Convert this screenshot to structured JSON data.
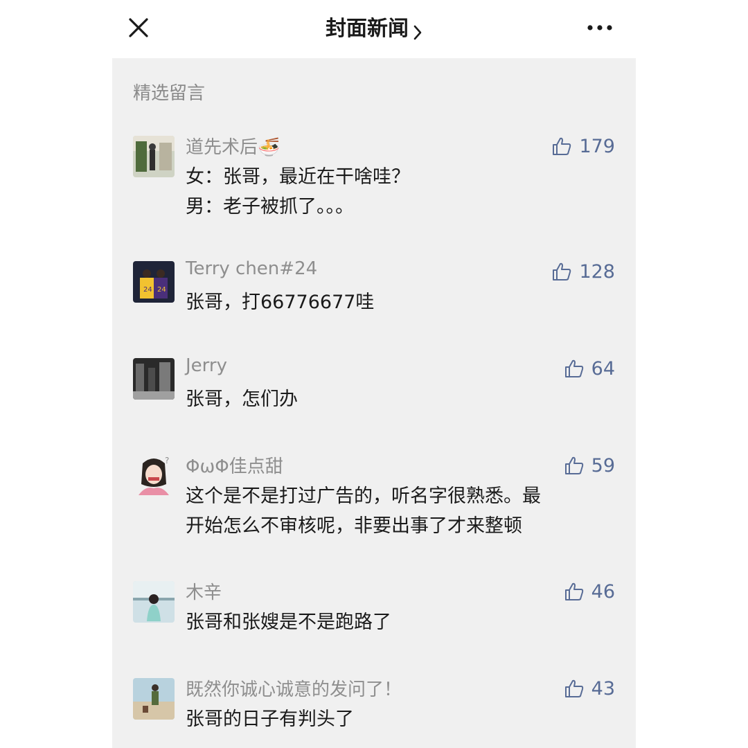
{
  "header": {
    "title": "封面新闻",
    "close_icon": "close-icon",
    "more_icon": "more-icon",
    "chevron_icon": "chevron-right-icon"
  },
  "section": {
    "label": "精选留言"
  },
  "colors": {
    "like_blue": "#576b95",
    "panel_bg": "#f0f0f0",
    "name_gray": "#8e8e8e"
  },
  "comments": [
    {
      "name": "道先术后",
      "name_emoji": "🍜",
      "lines": [
        "女：张哥，最近在干啥哇？",
        "男：老子被抓了。。。"
      ],
      "likes": "179"
    },
    {
      "name": "Terry chen#24",
      "lines": [
        "张哥，打66776677哇"
      ],
      "likes": "128"
    },
    {
      "name": "Jerry",
      "lines": [
        "张哥，怎们办"
      ],
      "likes": "64"
    },
    {
      "name": "ΦωΦ佳点甜",
      "lines": [
        "这个是不是打过广告的，听名字很熟悉。最",
        "开始怎么不审核呢，非要出事了才来整顿"
      ],
      "likes": "59"
    },
    {
      "name": "木辛",
      "lines": [
        "张哥和张嫂是不是跑路了"
      ],
      "likes": "46"
    },
    {
      "name": "既然你诚心诚意的发问了！",
      "lines": [
        "张哥的日子有判头了"
      ],
      "likes": "43"
    }
  ]
}
